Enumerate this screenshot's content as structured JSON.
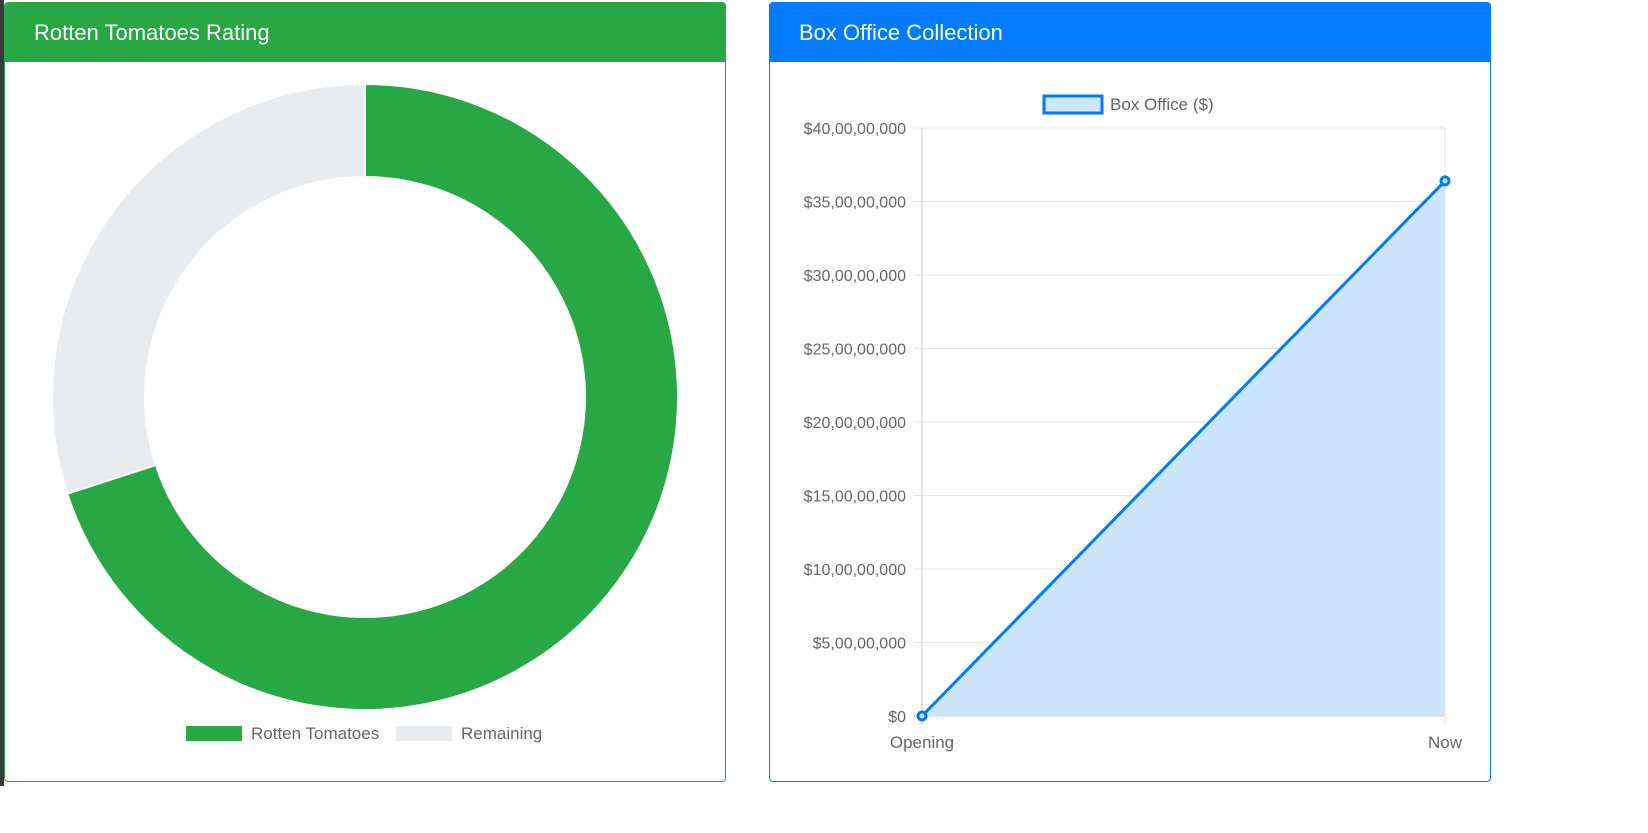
{
  "rating_card": {
    "title": "Rotten Tomatoes Rating",
    "chart_data": {
      "type": "pie",
      "variant": "doughnut",
      "categories": [
        "Rotten Tomatoes",
        "Remaining"
      ],
      "values": [
        70,
        30
      ],
      "colors": [
        "#28a745",
        "#e9ecef"
      ],
      "legend_position": "bottom"
    }
  },
  "box_office_card": {
    "title": "Box Office Collection",
    "chart_data": {
      "type": "area",
      "categories": [
        "Opening",
        "Now"
      ],
      "series": [
        {
          "name": "Box Office ($)",
          "values": [
            0,
            3640000000
          ]
        }
      ],
      "ylim": [
        0,
        4000000000
      ],
      "yticks": [
        "$0",
        "$5,00,00,000",
        "$10,00,00,000",
        "$15,00,00,000",
        "$20,00,00,000",
        "$25,00,00,000",
        "$30,00,00,000",
        "$35,00,00,000",
        "$40,00,00,000"
      ],
      "grid": true,
      "legend_position": "top",
      "line_color": "#007bff",
      "fill_color": "#cce5fb"
    }
  }
}
